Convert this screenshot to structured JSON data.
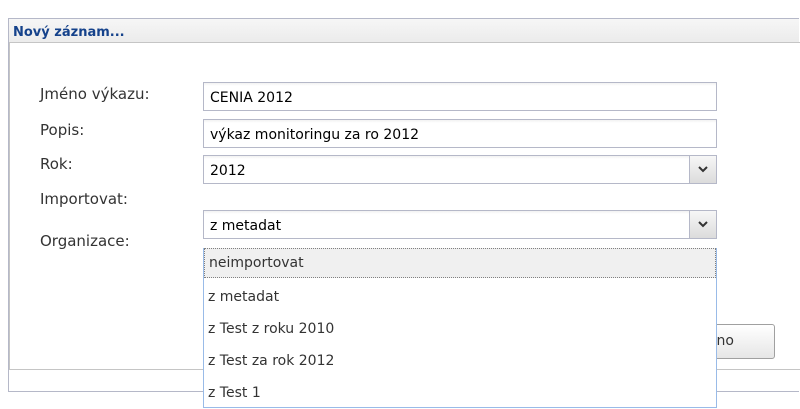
{
  "window": {
    "title": "Nový záznam..."
  },
  "form": {
    "name": {
      "label": "Jméno výkazu:",
      "value": "CENIA 2012"
    },
    "description": {
      "label": "Popis:",
      "value": "výkaz monitoringu za ro 2012"
    },
    "year": {
      "label": "Rok:",
      "value": "2012"
    },
    "import": {
      "label": "Importovat:",
      "value": "z metadat"
    },
    "organization": {
      "label": "Organizace:"
    }
  },
  "dropdown": {
    "items": [
      "neimportovat",
      "z metadat",
      "z Test z roku 2010",
      "z Test za rok 2012",
      "z Test 1"
    ],
    "highlighted_index": 0
  },
  "button": {
    "label": "rno"
  },
  "icons": {
    "combo_trigger": "chevron-down-icon"
  }
}
